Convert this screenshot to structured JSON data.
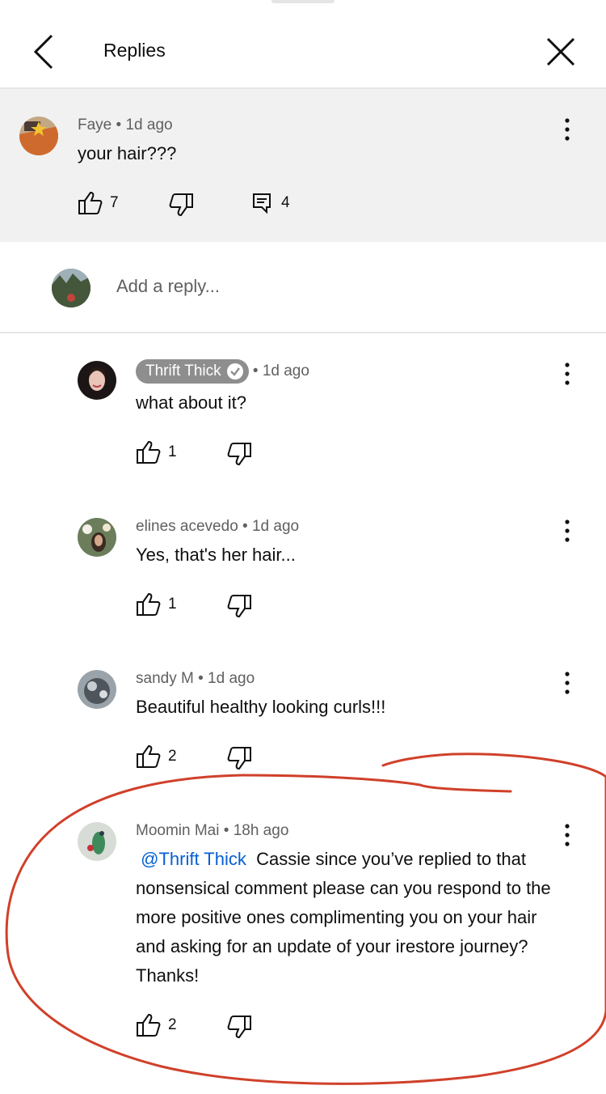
{
  "header": {
    "title": "Replies"
  },
  "parent_comment": {
    "author": "Faye",
    "time": "1d ago",
    "text": "your hair???",
    "likes": "7",
    "replies": "4"
  },
  "reply_box": {
    "placeholder": "Add a reply..."
  },
  "replies": [
    {
      "author": "Thrift Thick",
      "time": "1d ago",
      "text": "what about it?",
      "likes": "1"
    },
    {
      "author": "elines acevedo",
      "time": "1d ago",
      "text": "Yes, that's her hair...",
      "likes": "1"
    },
    {
      "author": "sandy M",
      "time": "1d ago",
      "text": "Beautiful healthy looking curls!!!",
      "likes": "2"
    },
    {
      "author": "Moomin Mai",
      "time": "18h ago",
      "mention": "@Thrift Thick",
      "text": "Cassie since you’ve replied to that nonsensical comment please can you respond to the more positive ones complimenting you on your hair and asking for an update of your irestore journey? Thanks!",
      "likes": "2"
    }
  ],
  "colors": {
    "accent": "#065fd4",
    "annotation": "#d0402a",
    "badge": "#8e8e8e"
  }
}
